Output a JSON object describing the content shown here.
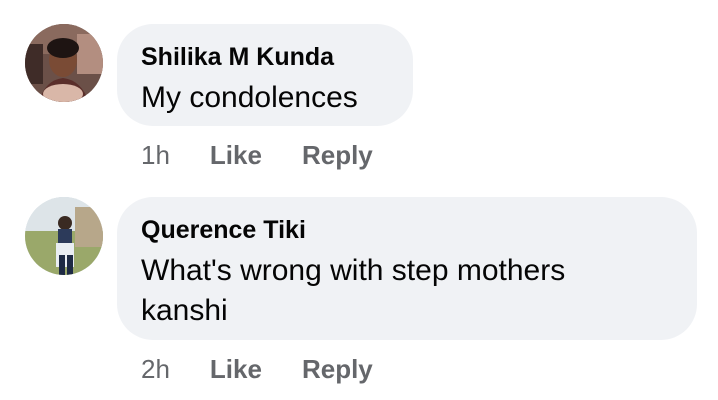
{
  "comments": [
    {
      "author": "Shilika M Kunda",
      "text": "My condolences",
      "time": "1h",
      "like_label": "Like",
      "reply_label": "Reply"
    },
    {
      "author": "Querence Tiki",
      "text": "What's wrong with step mothers kanshi",
      "time": "2h",
      "like_label": "Like",
      "reply_label": "Reply"
    }
  ],
  "colors": {
    "bubble": "#f0f2f5",
    "text": "#050505",
    "meta": "#65676b"
  }
}
